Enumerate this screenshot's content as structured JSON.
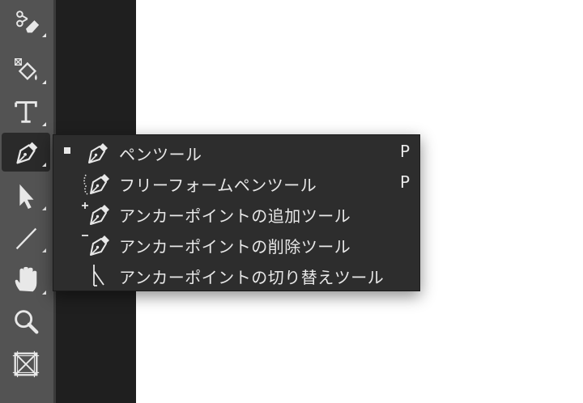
{
  "toolbar": {
    "tools": [
      {
        "name": "background-eraser-tool",
        "icon": "background-eraser-icon"
      },
      {
        "name": "paint-bucket-tool",
        "icon": "paint-bucket-icon"
      },
      {
        "name": "type-tool",
        "icon": "type-icon"
      },
      {
        "name": "pen-tool",
        "icon": "pen-icon",
        "active": true
      },
      {
        "name": "path-selection-tool",
        "icon": "arrow-icon"
      },
      {
        "name": "line-tool",
        "icon": "line-icon"
      },
      {
        "name": "hand-tool",
        "icon": "hand-icon"
      },
      {
        "name": "zoom-tool",
        "icon": "magnifier-icon"
      },
      {
        "name": "frame-tool",
        "icon": "frame-icon"
      }
    ]
  },
  "flyout": {
    "items": [
      {
        "label": "ペンツール",
        "shortcut": "P",
        "selected": true,
        "icon": "pen-icon"
      },
      {
        "label": "フリーフォームペンツール",
        "shortcut": "P",
        "selected": false,
        "icon": "freeform-pen-icon"
      },
      {
        "label": "アンカーポイントの追加ツール",
        "shortcut": "",
        "selected": false,
        "icon": "add-anchor-point-icon"
      },
      {
        "label": "アンカーポイントの削除ツール",
        "shortcut": "",
        "selected": false,
        "icon": "delete-anchor-point-icon"
      },
      {
        "label": "アンカーポイントの切り替えツール",
        "shortcut": "",
        "selected": false,
        "icon": "convert-point-icon"
      }
    ]
  },
  "colors": {
    "toolbar_bg": "#535353",
    "panel_dark": "#1f1f1f",
    "menu_bg": "#2d2d2d",
    "menu_text": "#e8e8e8",
    "canvas": "#ffffff"
  }
}
